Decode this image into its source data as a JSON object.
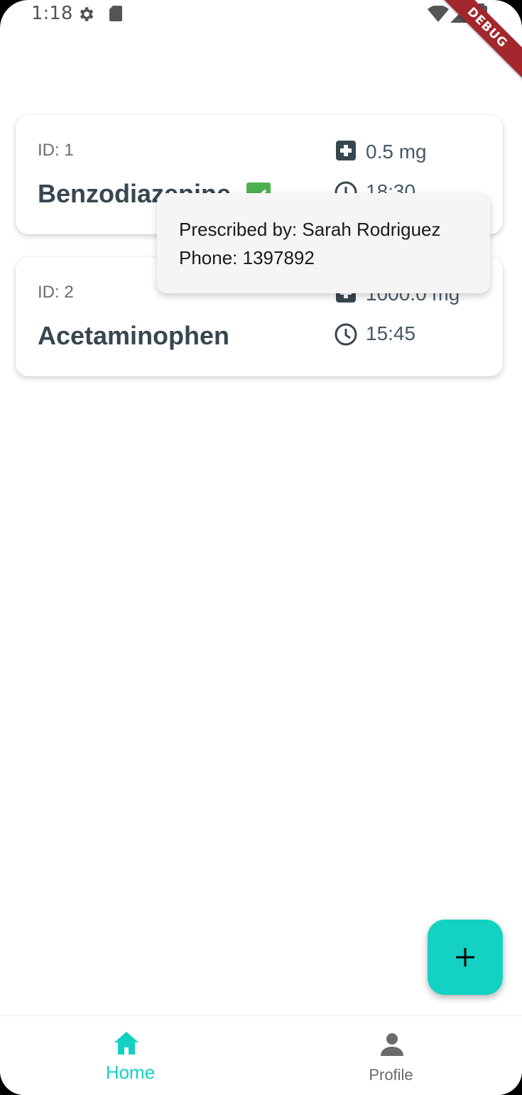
{
  "status_bar": {
    "time": "1:18",
    "icons": [
      "gear-icon",
      "sd-card-icon",
      "wifi-icon",
      "cell-signal-icon",
      "battery-icon"
    ]
  },
  "debug_banner": "DEBUG",
  "medications": [
    {
      "id_label": "ID: 1",
      "name": "Benzodiazepine",
      "dose": "0.5 mg",
      "time": "18:30",
      "taken": true
    },
    {
      "id_label": "ID: 2",
      "name": "Acetaminophen",
      "dose": "1000.0 mg",
      "time": "15:45",
      "taken": false
    }
  ],
  "tooltip": {
    "prescribed_by": "Prescribed by: Sarah Rodriguez",
    "phone": "Phone: 1397892"
  },
  "fab": {
    "icon": "plus-icon"
  },
  "bottom_nav": {
    "items": [
      {
        "label": "Home",
        "icon": "home-icon",
        "active": true
      },
      {
        "label": "Profile",
        "icon": "person-icon",
        "active": false
      }
    ]
  },
  "colors": {
    "accent": "#13d1c3",
    "text_primary": "#37474f",
    "text_secondary": "#6b6b6b",
    "check_green": "#4caf50",
    "debug_red": "#a3262c"
  }
}
